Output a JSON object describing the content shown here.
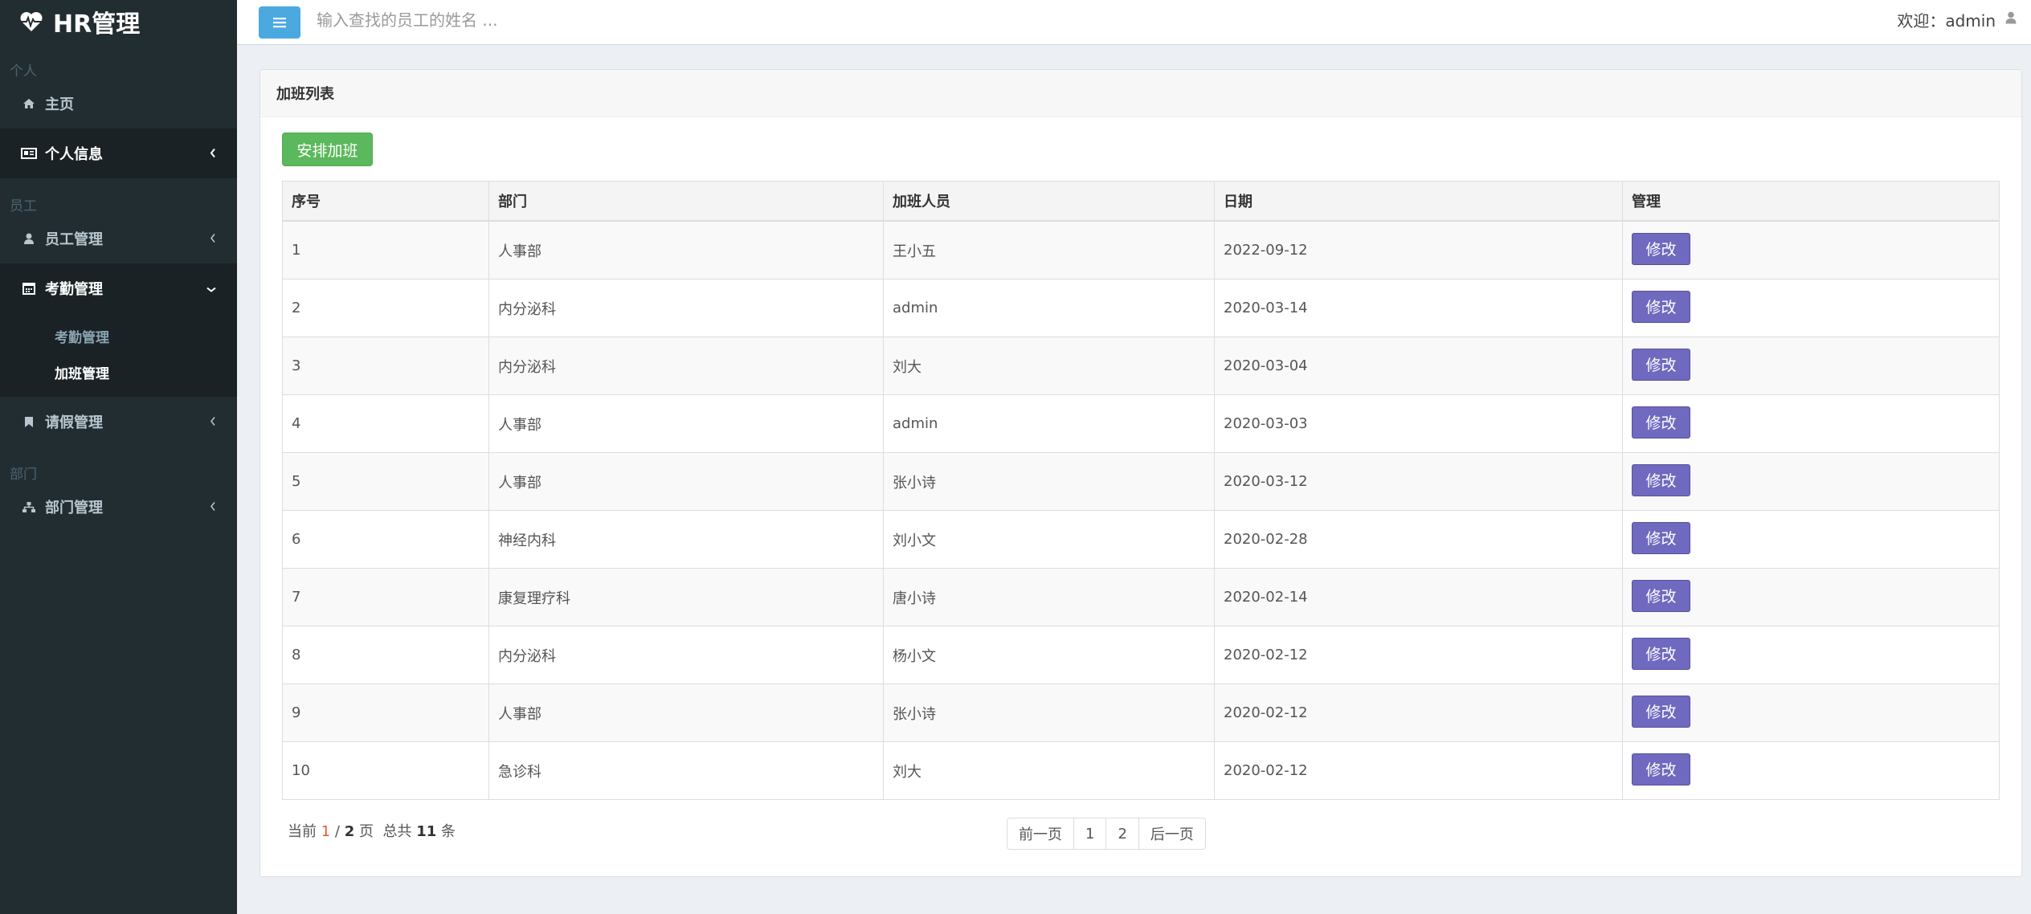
{
  "app": {
    "logo_text": "HR管理"
  },
  "sidebar": {
    "header_personal": "个人",
    "item_home": "主页",
    "item_personal_info": "个人信息",
    "header_staff": "员工",
    "item_staff_mgmt": "员工管理",
    "item_attendance": "考勤管理",
    "sub_attendance": "考勤管理",
    "sub_overtime": "加班管理",
    "item_leave": "请假管理",
    "header_dept": "部门",
    "item_dept": "部门管理"
  },
  "topbar": {
    "search_placeholder": "输入查找的员工的姓名 ...",
    "welcome": "欢迎：admin"
  },
  "box": {
    "title": "加班列表",
    "add_button": "安排加班"
  },
  "table": {
    "headers": [
      "序号",
      "部门",
      "加班人员",
      "日期",
      "管理"
    ],
    "edit_label": "修改",
    "rows": [
      [
        "1",
        "人事部",
        "王小五",
        "2022-09-12"
      ],
      [
        "2",
        "内分泌科",
        "admin",
        "2020-03-14"
      ],
      [
        "3",
        "内分泌科",
        "刘大",
        "2020-03-04"
      ],
      [
        "4",
        "人事部",
        "admin",
        "2020-03-03"
      ],
      [
        "5",
        "人事部",
        "张小诗",
        "2020-03-12"
      ],
      [
        "6",
        "神经内科",
        "刘小文",
        "2020-02-28"
      ],
      [
        "7",
        "康复理疗科",
        "唐小诗",
        "2020-02-14"
      ],
      [
        "8",
        "内分泌科",
        "杨小文",
        "2020-02-12"
      ],
      [
        "9",
        "人事部",
        "张小诗",
        "2020-02-12"
      ],
      [
        "10",
        "急诊科",
        "刘大",
        "2020-02-12"
      ]
    ]
  },
  "pager": {
    "prefix": "当前",
    "current": "1",
    "separator": "/",
    "total_pages": "2",
    "page_word": "页",
    "total_prefix": "总共",
    "total_items": "11",
    "item_word": "条",
    "prev": "前一页",
    "pages": [
      "1",
      "2"
    ],
    "next": "后一页"
  },
  "colors": {
    "sidebar": "#222d32",
    "add_button": "#5cb85c",
    "edit_button": "#6f6abf",
    "toggle": "#4ba9e0"
  }
}
